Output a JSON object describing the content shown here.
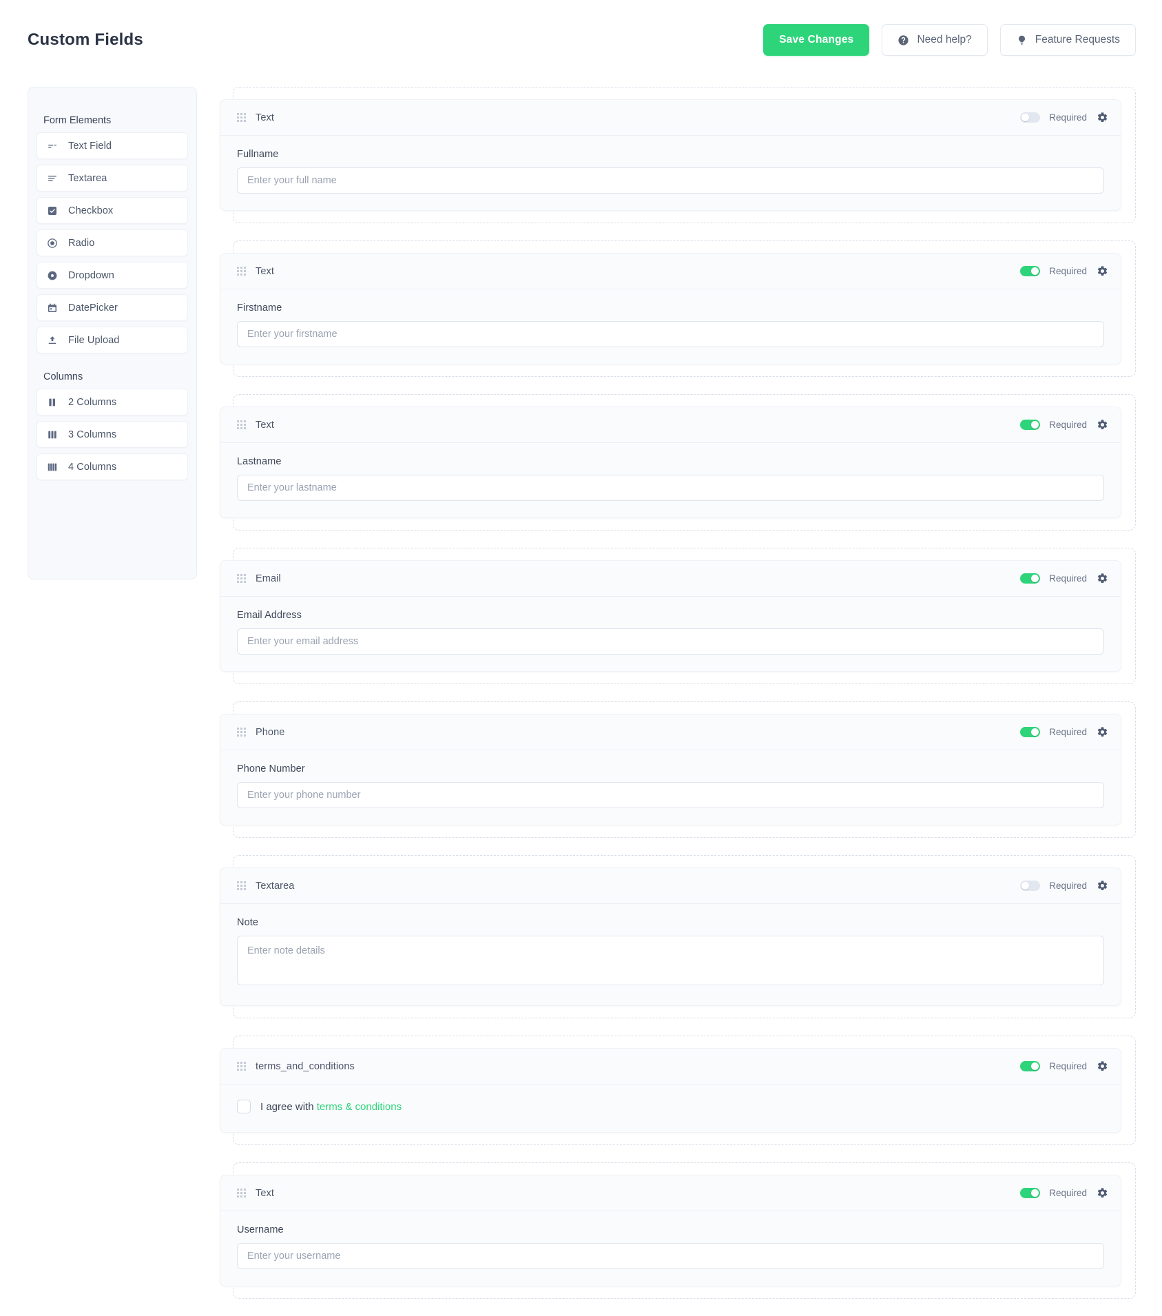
{
  "header": {
    "title": "Custom Fields",
    "buttons": [
      {
        "label": "Save Changes",
        "style": "primary",
        "icon": null
      },
      {
        "label": "Need help?",
        "style": "ghost",
        "icon": "question-circle-icon"
      },
      {
        "label": "Feature Requests",
        "style": "ghost",
        "icon": "lightbulb-icon"
      }
    ]
  },
  "sidebar": {
    "sections": [
      {
        "title": "Form Elements",
        "items": [
          {
            "label": "Text Field",
            "icon": "text-field-icon"
          },
          {
            "label": "Textarea",
            "icon": "textarea-icon"
          },
          {
            "label": "Checkbox",
            "icon": "checkbox-icon"
          },
          {
            "label": "Radio",
            "icon": "radio-icon"
          },
          {
            "label": "Dropdown",
            "icon": "dropdown-icon"
          },
          {
            "label": "DatePicker",
            "icon": "calendar-icon"
          },
          {
            "label": "File Upload",
            "icon": "upload-icon"
          }
        ]
      },
      {
        "title": "Columns",
        "items": [
          {
            "label": "2 Columns",
            "icon": "two-columns-icon"
          },
          {
            "label": "3 Columns",
            "icon": "three-columns-icon"
          },
          {
            "label": "4 Columns",
            "icon": "four-columns-icon"
          }
        ]
      }
    ]
  },
  "common": {
    "required_label": "Required",
    "gear_icon": "gear-icon",
    "drag_icon": "drag-handle-icon"
  },
  "fields": [
    {
      "type": "Text",
      "required": false,
      "label": "Fullname",
      "placeholder": "Enter your full name",
      "control": "input"
    },
    {
      "type": "Text",
      "required": true,
      "label": "Firstname",
      "placeholder": "Enter your firstname",
      "control": "input"
    },
    {
      "type": "Text",
      "required": true,
      "label": "Lastname",
      "placeholder": "Enter your lastname",
      "control": "input"
    },
    {
      "type": "Email",
      "required": true,
      "label": "Email Address",
      "placeholder": "Enter your email address",
      "control": "input"
    },
    {
      "type": "Phone",
      "required": true,
      "label": "Phone Number",
      "placeholder": "Enter your phone number",
      "control": "input"
    },
    {
      "type": "Textarea",
      "required": false,
      "label": "Note",
      "placeholder": "Enter note details",
      "control": "textarea"
    },
    {
      "type": "terms_and_conditions",
      "required": true,
      "control": "checkbox",
      "checkbox_text": "I agree with ",
      "checkbox_link": "terms & conditions",
      "checked": false
    },
    {
      "type": "Text",
      "required": true,
      "label": "Username",
      "placeholder": "Enter your username",
      "control": "input"
    }
  ],
  "colors": {
    "accent": "#2ed47a",
    "title": "#2b3445",
    "muted": "#6a7488",
    "card_bg": "#fafbfd",
    "page_bg": "#ffffff"
  }
}
